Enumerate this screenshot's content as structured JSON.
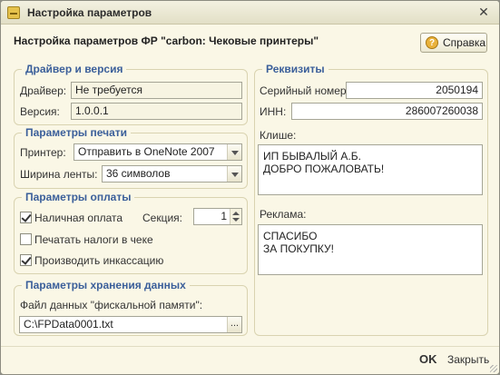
{
  "window": {
    "title": "Настройка параметров",
    "header": "Настройка параметров ФР \"carbon: Чековые принтеры\"",
    "help_label": "Справка"
  },
  "driver": {
    "title": "Драйвер и версия",
    "driver_label": "Драйвер:",
    "driver_value": "Не требуется",
    "version_label": "Версия:",
    "version_value": "1.0.0.1"
  },
  "print": {
    "title": "Параметры печати",
    "printer_label": "Принтер:",
    "printer_value": "Отправить в OneNote 2007",
    "width_label": "Ширина ленты:",
    "width_value": "36 символов"
  },
  "payment": {
    "title": "Параметры оплаты",
    "cash_label": "Наличная оплата",
    "cash_checked": true,
    "section_label": "Секция:",
    "section_value": "1",
    "taxes_label": "Печатать налоги в чеке",
    "taxes_checked": false,
    "collect_label": "Производить инкассацию",
    "collect_checked": true
  },
  "storage": {
    "title": "Параметры хранения данных",
    "file_label": "Файл данных \"фискальной памяти\":",
    "file_value": "C:\\FPData0001.txt"
  },
  "requisites": {
    "title": "Реквизиты",
    "serial_label": "Серийный номер:",
    "serial_value": "2050194",
    "inn_label": "ИНН:",
    "inn_value": "286007260038",
    "cliche_label": "Клише:",
    "cliche_value": "ИП БЫВАЛЫЙ А.Б.\nДОБРО ПОЖАЛОВАТЬ!",
    "ad_label": "Реклама:",
    "ad_value": "СПАСИБО\nЗА ПОКУПКУ!"
  },
  "footer": {
    "ok_label": "OK",
    "close_label": "Закрыть"
  }
}
